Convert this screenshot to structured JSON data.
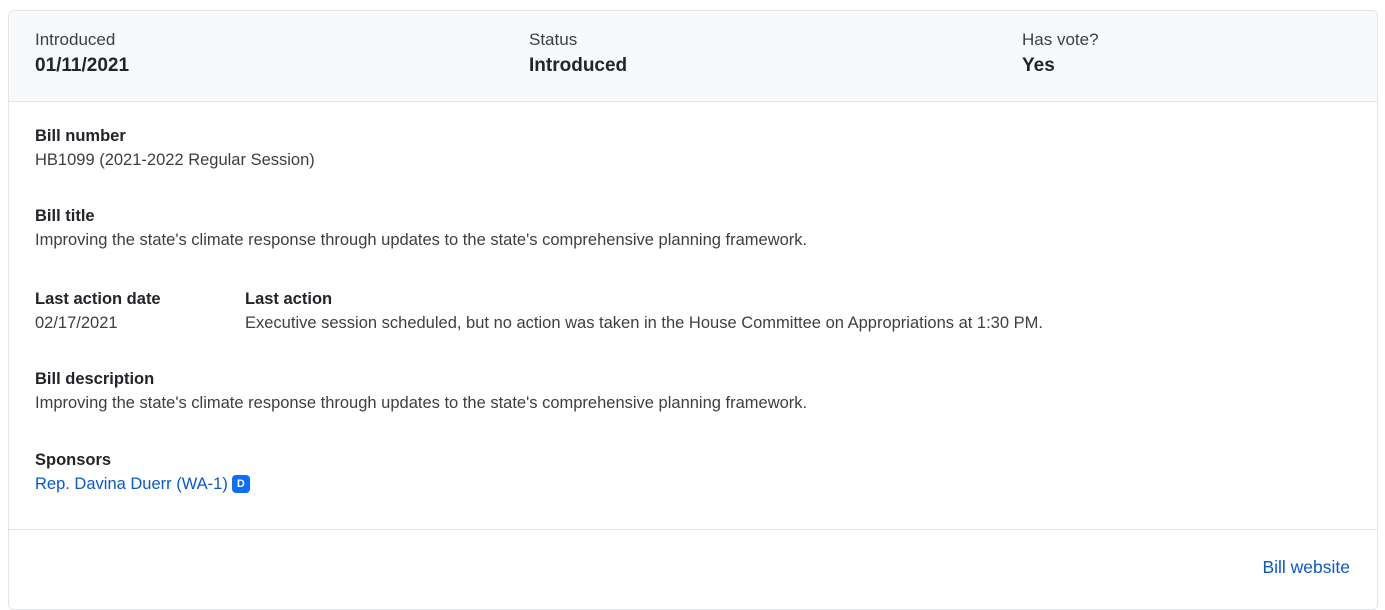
{
  "header": {
    "introduced_label": "Introduced",
    "introduced_value": "01/11/2021",
    "status_label": "Status",
    "status_value": "Introduced",
    "vote_label": "Has vote?",
    "vote_value": "Yes"
  },
  "bill": {
    "number_label": "Bill number",
    "number_value": "HB1099 (2021-2022 Regular Session)",
    "title_label": "Bill title",
    "title_value": "Improving the state's climate response through updates to the state's comprehensive planning framework.",
    "last_action_date_label": "Last action date",
    "last_action_date_value": "02/17/2021",
    "last_action_label": "Last action",
    "last_action_value": "Executive session scheduled, but no action was taken in the House Committee on Appropriations at 1:30 PM.",
    "description_label": "Bill description",
    "description_value": "Improving the state's climate response through updates to the state's comprehensive planning framework.",
    "sponsors_label": "Sponsors",
    "sponsors": [
      {
        "name": "Rep. Davina Duerr (WA-1)",
        "party": "D",
        "party_color": "#0d6efd"
      }
    ]
  },
  "footer": {
    "website_link": "Bill website"
  },
  "colors": {
    "link": "#0a58ca",
    "header_bg": "#f8f9fa",
    "border": "#e2e4e7"
  }
}
